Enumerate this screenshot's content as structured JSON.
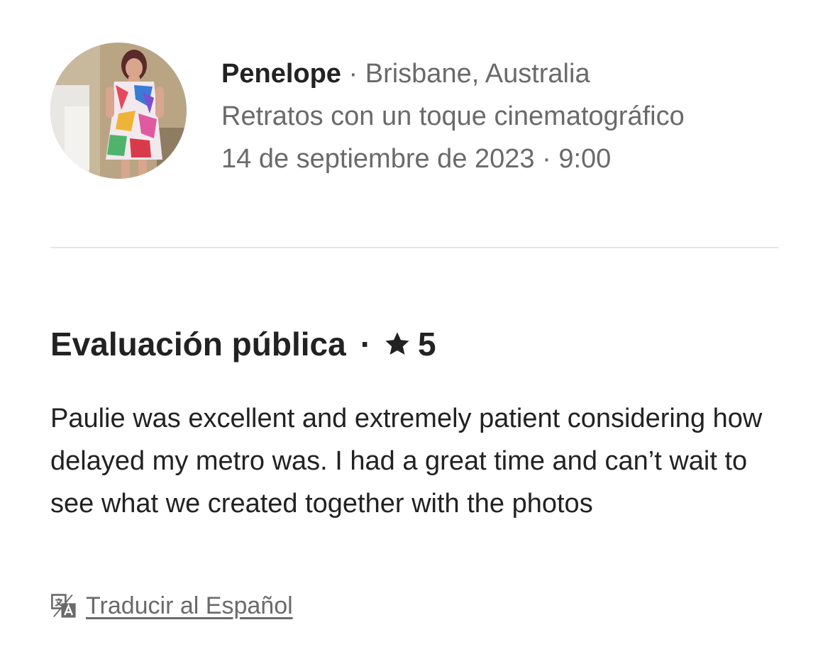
{
  "reviewer": {
    "name": "Penelope",
    "separator": "·",
    "location": "Brisbane, Australia",
    "experience": "Retratos con un toque cinematográfico",
    "date": "14 de septiembre de 2023",
    "time": "9:00"
  },
  "review": {
    "heading": "Evaluación pública",
    "separator": "·",
    "rating": "5",
    "text": "Paulie was excellent and extremely patient considering how delayed my metro was. I had a great time and can’t wait to see what we created together with the photos"
  },
  "translate": {
    "label": "Traducir al Español",
    "icon": "translate-icon"
  },
  "colors": {
    "primary_text": "#222222",
    "secondary_text": "#6a6a6a",
    "divider": "#e6e6e6"
  }
}
